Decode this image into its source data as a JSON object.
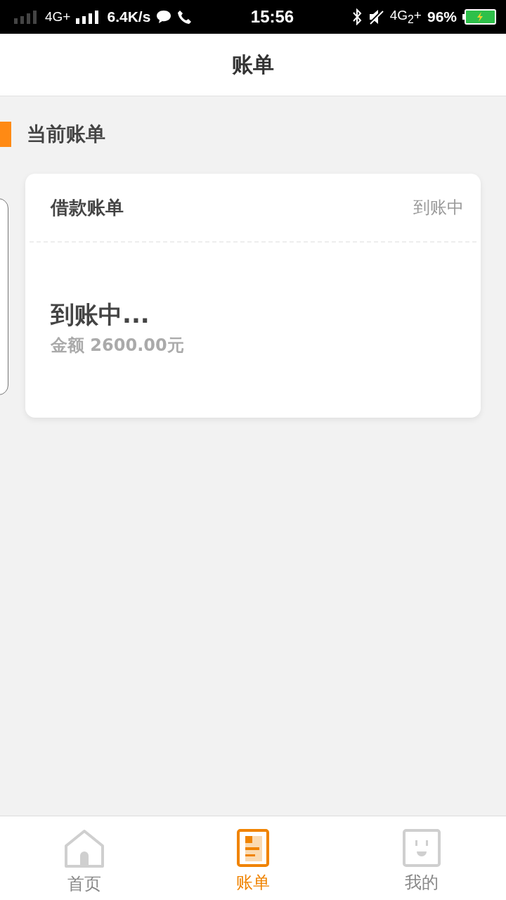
{
  "status_bar": {
    "network_1": "4G+",
    "speed": "6.4K/s",
    "time": "15:56",
    "network_2": "4G$_{2}$+",
    "battery": "96%"
  },
  "header": {
    "title": "账单"
  },
  "section": {
    "title": "当前账单"
  },
  "bill_card": {
    "title": "借款账单",
    "status": "到账中",
    "headline": "到账中...",
    "amount": "金额 2600.00元"
  },
  "tabs": [
    {
      "label": "首页",
      "kind": "home",
      "selected": false
    },
    {
      "label": "账单",
      "kind": "bill",
      "selected": true
    },
    {
      "label": "我的",
      "kind": "profile",
      "selected": false
    }
  ]
}
